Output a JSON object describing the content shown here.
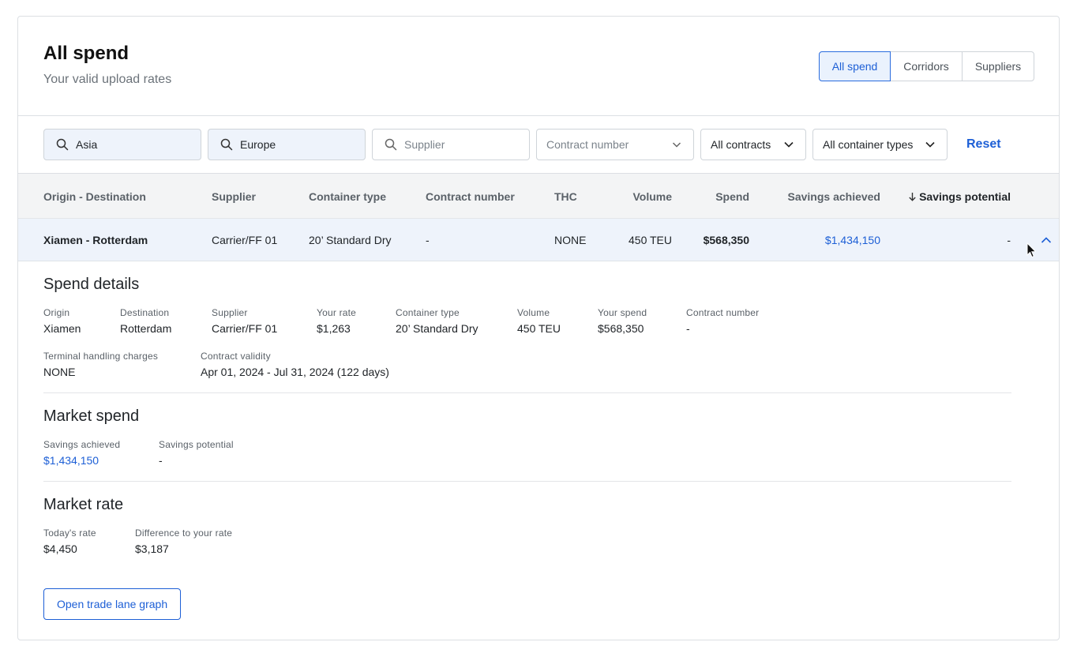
{
  "header": {
    "title": "All spend",
    "subtitle": "Your valid upload rates",
    "tabs": [
      "All spend",
      "Corridors",
      "Suppliers"
    ]
  },
  "filters": {
    "origin": "Asia",
    "destination": "Europe",
    "supplier_placeholder": "Supplier",
    "contract_number_placeholder": "Contract number",
    "contracts": "All contracts",
    "container_types": "All container types",
    "reset": "Reset"
  },
  "table": {
    "columns": [
      "Origin - Destination",
      "Supplier",
      "Container type",
      "Contract number",
      "THC",
      "Volume",
      "Spend",
      "Savings achieved",
      "Savings potential"
    ],
    "sort_column": "Savings potential",
    "sort_direction": "descending",
    "row": {
      "lane": "Xiamen - Rotterdam",
      "supplier": "Carrier/FF 01",
      "container_type": "20’ Standard Dry",
      "contract_number": "-",
      "thc": "NONE",
      "volume": "450 TEU",
      "spend": "$568,350",
      "savings_achieved": "$1,434,150",
      "savings_potential": "-"
    }
  },
  "spend_details": {
    "title": "Spend details",
    "fields": [
      {
        "label": "Origin",
        "value": "Xiamen"
      },
      {
        "label": "Destination",
        "value": "Rotterdam"
      },
      {
        "label": "Supplier",
        "value": "Carrier/FF 01"
      },
      {
        "label": "Your rate",
        "value": "$1,263"
      },
      {
        "label": "Container type",
        "value": "20’ Standard Dry"
      },
      {
        "label": "Volume",
        "value": "450 TEU"
      },
      {
        "label": "Your spend",
        "value": "$568,350"
      },
      {
        "label": "Contract number",
        "value": "-"
      },
      {
        "label": "Terminal handling charges",
        "value": "NONE"
      },
      {
        "label": "Contract validity",
        "value": "Apr 01, 2024 - Jul 31, 2024 (122 days)"
      }
    ]
  },
  "market_spend": {
    "title": "Market spend",
    "fields": [
      {
        "label": "Savings achieved",
        "value": "$1,434,150"
      },
      {
        "label": "Savings potential",
        "value": "-"
      }
    ]
  },
  "market_rate": {
    "title": "Market rate",
    "fields": [
      {
        "label": "Today's rate",
        "value": "$4,450"
      },
      {
        "label": "Difference to your rate",
        "value": "$3,187"
      }
    ]
  },
  "actions": {
    "open_graph": "Open trade lane graph"
  },
  "colors": {
    "accent": "#1d5fd6",
    "row_highlight": "#eef3fb",
    "header_bg": "#f3f4f5"
  },
  "icons": [
    "search-icon",
    "chevron-down-icon",
    "arrow-down-icon",
    "chevron-up-icon",
    "mouse-cursor-icon"
  ]
}
